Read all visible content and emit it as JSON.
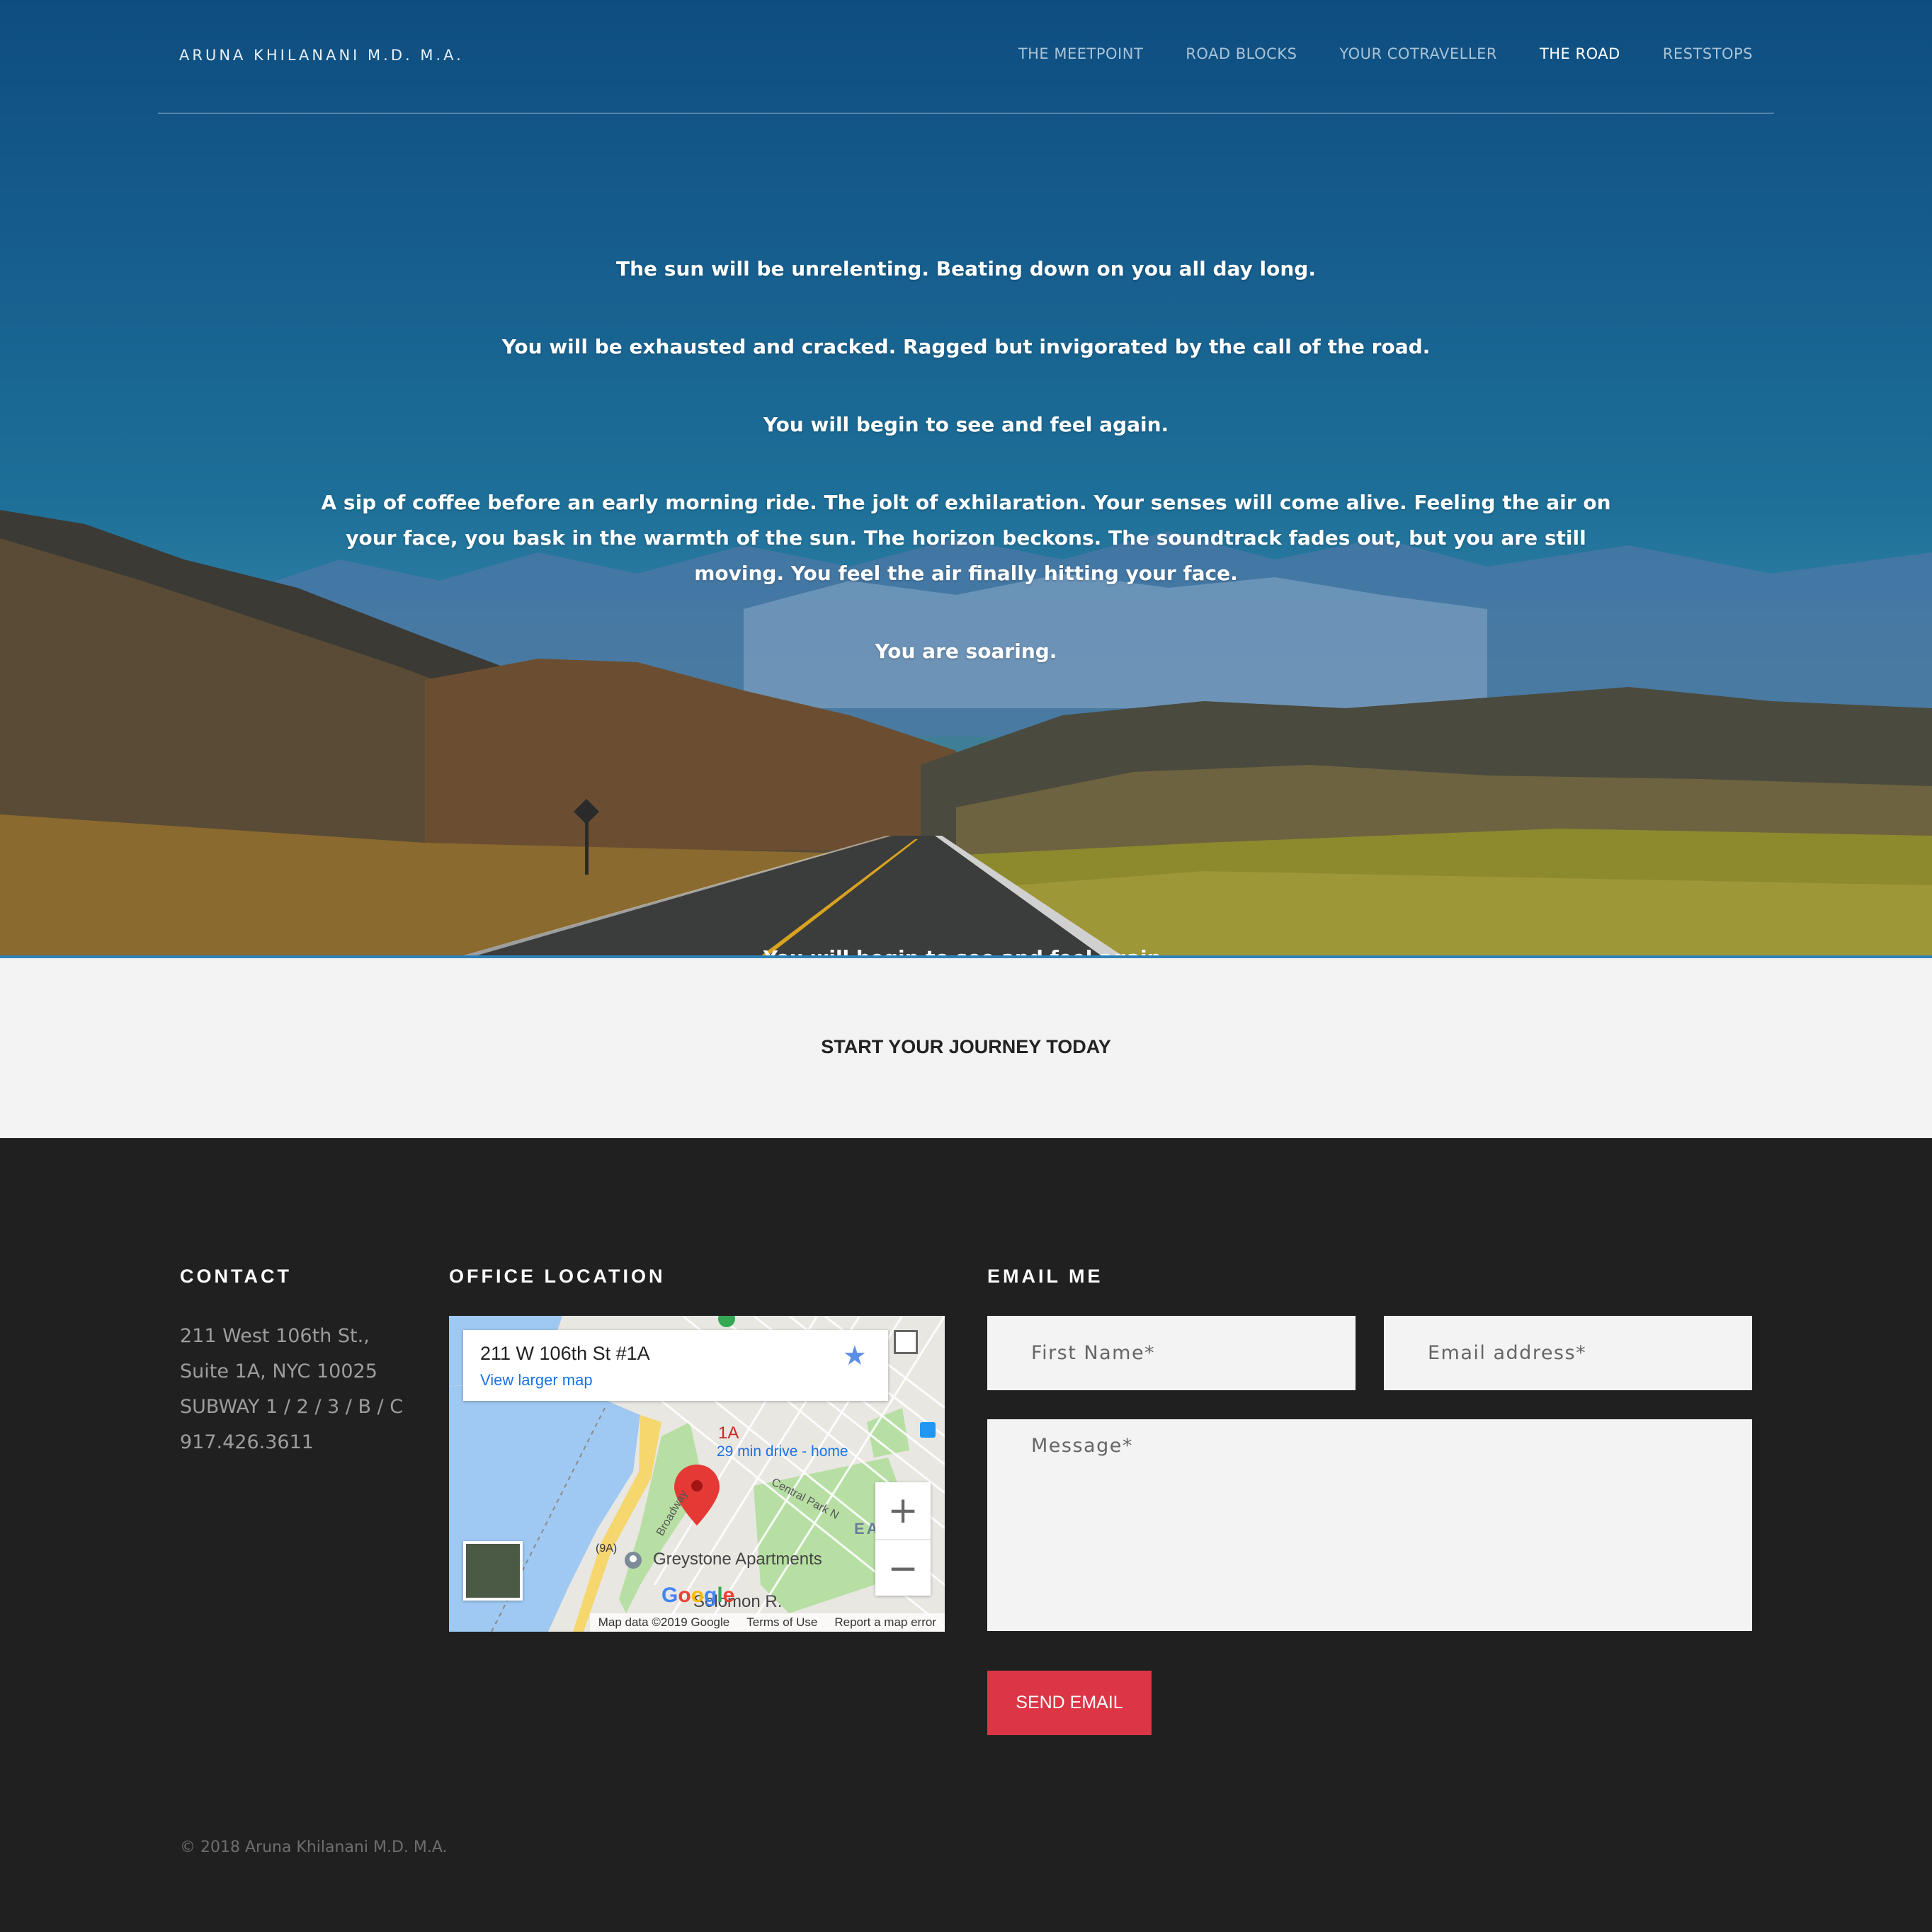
{
  "header": {
    "brand": "ARUNA KHILANANI M.D. M.A.",
    "nav": [
      {
        "label": "THE MEETPOINT",
        "active": false
      },
      {
        "label": "ROAD BLOCKS",
        "active": false
      },
      {
        "label": "YOUR COTRAVELLER",
        "active": false
      },
      {
        "label": "THE ROAD",
        "active": true
      },
      {
        "label": "RESTSTOPS",
        "active": false
      }
    ]
  },
  "hero": {
    "paragraphs": [
      "The sun will be unrelenting. Beating down on you all day long.",
      "You will be exhausted and cracked. Ragged but invigorated by the call of the road.",
      "You will begin to see and feel again.",
      "A sip of coffee before an early morning ride. The jolt of exhilaration. Your senses will come alive. Feeling the air on your face, you bask in the warmth of the sun. The horizon beckons. The soundtrack fades out, but you are still moving. You feel the air finally hitting your face.",
      "You are soaring."
    ],
    "overflow_text": "You will begin to see and feel again."
  },
  "cta": {
    "title": "START YOUR JOURNEY TODAY"
  },
  "footer": {
    "contact": {
      "title": "CONTACT",
      "lines": [
        "211 West 106th St.,",
        "Suite 1A, NYC 10025",
        "SUBWAY 1 / 2 / 3 / B / C",
        "917.426.3611"
      ]
    },
    "office": {
      "title": "OFFICE LOCATION",
      "map": {
        "address": "211 W 106th St #1A",
        "larger_map": "View larger map",
        "pin_label": "1A",
        "drive": "29 min drive - home",
        "place": "Greystone Apartments",
        "place2": "Solomon R.",
        "street1": "Broadway",
        "street2": "Central Park N",
        "route": "9A",
        "district": "EA",
        "zoom_in": "+",
        "zoom_out": "−",
        "attribution": [
          "Map data ©2019 Google",
          "Terms of Use",
          "Report a map error"
        ],
        "logo": "Google"
      }
    },
    "email": {
      "title": "EMAIL ME",
      "first_name_placeholder": "First Name*",
      "email_placeholder": "Email address*",
      "message_placeholder": "Message*",
      "send_label": "SEND EMAIL"
    },
    "copyright": "© 2018 Aruna Khilanani M.D. M.A."
  },
  "colors": {
    "sky": "#0e4d80",
    "cta_band": "#f3f3f3",
    "footer_bg": "#202020",
    "send_button": "#dc3545",
    "link_blue": "#1a73e8"
  }
}
